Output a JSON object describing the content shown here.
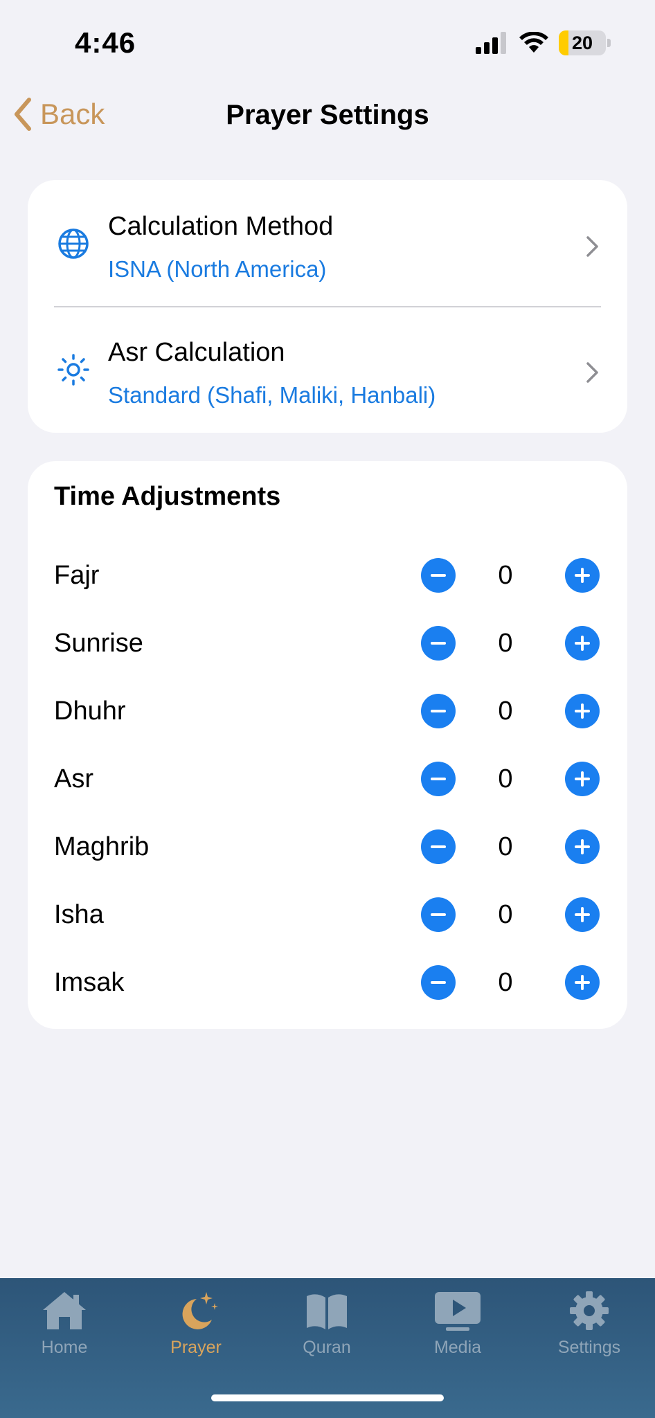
{
  "status_bar": {
    "time": "4:46",
    "battery_level": "20",
    "battery_fraction": 0.2,
    "icons": [
      "cellular-signal-icon",
      "wifi-icon",
      "battery-icon"
    ]
  },
  "nav": {
    "back_label": "Back",
    "title": "Prayer Settings",
    "accent_color": "#c8965a"
  },
  "calculation": {
    "method": {
      "title": "Calculation Method",
      "value": "ISNA (North America)",
      "icon": "globe-icon"
    },
    "asr": {
      "title": "Asr Calculation",
      "value": "Standard (Shafi, Maliki, Hanbali)",
      "icon": "sun-icon"
    }
  },
  "adjustments": {
    "title": "Time Adjustments",
    "rows": [
      {
        "name": "Fajr",
        "value": "0"
      },
      {
        "name": "Sunrise",
        "value": "0"
      },
      {
        "name": "Dhuhr",
        "value": "0"
      },
      {
        "name": "Asr",
        "value": "0"
      },
      {
        "name": "Maghrib",
        "value": "0"
      },
      {
        "name": "Isha",
        "value": "0"
      },
      {
        "name": "Imsak",
        "value": "0"
      }
    ]
  },
  "tab_bar": {
    "tabs": [
      {
        "label": "Home",
        "icon": "house-icon"
      },
      {
        "label": "Prayer",
        "icon": "moon-stars-icon",
        "active": true
      },
      {
        "label": "Quran",
        "icon": "book-icon"
      },
      {
        "label": "Media",
        "icon": "play-screen-icon"
      },
      {
        "label": "Settings",
        "icon": "gear-icon"
      }
    ]
  },
  "colors": {
    "accent_blue": "#1a7ff0",
    "gold": "#d9a45c",
    "tab_bar_bg": "#2d5578"
  }
}
